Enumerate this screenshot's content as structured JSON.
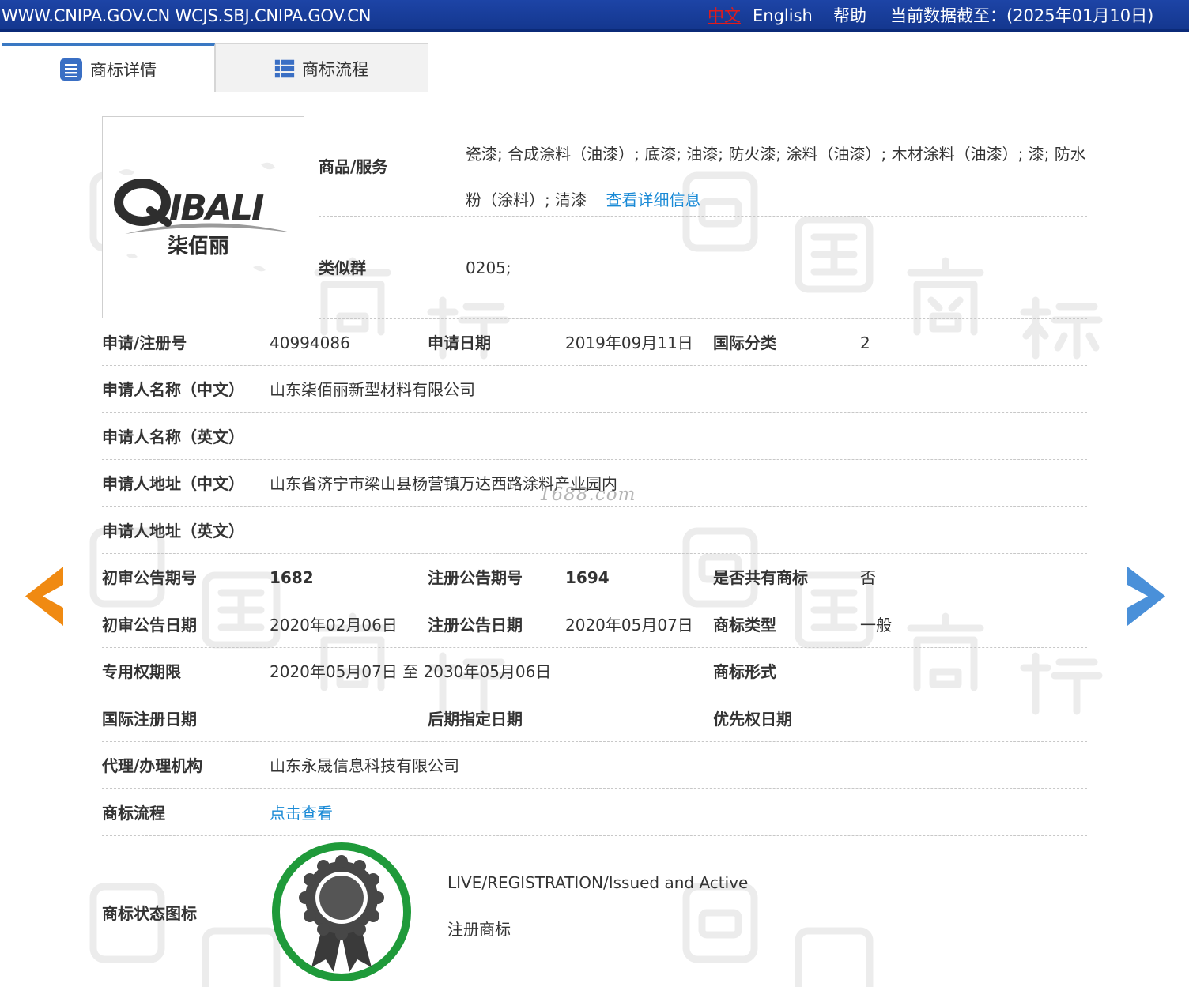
{
  "topbar": {
    "domains": "WWW.CNIPA.GOV.CN WCJS.SBJ.CNIPA.GOV.CN",
    "lang_zh": "中文",
    "lang_en": "English",
    "help": "帮助",
    "data_cutoff": "当前数据截至：(2025年01月10日)"
  },
  "tabs": [
    {
      "label": "商标详情",
      "icon": "list-doc-icon",
      "active": true
    },
    {
      "label": "商标流程",
      "icon": "table-list-icon",
      "active": false
    }
  ],
  "logo": {
    "latin_text": "QIBALI",
    "chinese_text": "柒佰丽"
  },
  "goods": {
    "label": "商品/服务",
    "text": "瓷漆; 合成涂料（油漆）; 底漆; 油漆; 防火漆; 涂料（油漆）; 木材涂料（油漆）; 漆; 防水粉（涂料）; 清漆",
    "detail_link": "查看详细信息"
  },
  "similar_group": {
    "label": "类似群",
    "value": "0205;"
  },
  "reg_no": {
    "label": "申请/注册号",
    "value": "40994086"
  },
  "apply_date": {
    "label": "申请日期",
    "value": "2019年09月11日"
  },
  "intl_class": {
    "label": "国际分类",
    "value": "2"
  },
  "applicant_cn": {
    "label": "申请人名称（中文）",
    "value": "山东柒佰丽新型材料有限公司"
  },
  "applicant_en": {
    "label": "申请人名称（英文）",
    "value": ""
  },
  "address_cn": {
    "label": "申请人地址（中文）",
    "value": "山东省济宁市梁山县杨营镇万达西路涂料产业园内"
  },
  "address_en": {
    "label": "申请人地址（英文）",
    "value": ""
  },
  "prelim_no": {
    "label": "初审公告期号",
    "value": "1682"
  },
  "reg_ann_no": {
    "label": "注册公告期号",
    "value": "1694"
  },
  "shared": {
    "label": "是否共有商标",
    "value": "否"
  },
  "prelim_date": {
    "label": "初审公告日期",
    "value": "2020年02月06日"
  },
  "reg_ann_date": {
    "label": "注册公告日期",
    "value": "2020年05月07日"
  },
  "tm_type": {
    "label": "商标类型",
    "value": "一般"
  },
  "exclusive_period": {
    "label": "专用权期限",
    "value": "2020年05月07日 至 2030年05月06日"
  },
  "tm_form": {
    "label": "商标形式",
    "value": ""
  },
  "intl_reg_date": {
    "label": "国际注册日期",
    "value": ""
  },
  "later_desig_date": {
    "label": "后期指定日期",
    "value": ""
  },
  "priority_date": {
    "label": "优先权日期",
    "value": ""
  },
  "agent": {
    "label": "代理/办理机构",
    "value": "山东永晟信息科技有限公司"
  },
  "process": {
    "label": "商标流程",
    "link": "点击查看"
  },
  "status": {
    "label": "商标状态图标",
    "en": "LIVE/REGISTRATION/Issued and Active",
    "cn": "注册商标",
    "icon": "registered-badge-icon",
    "ring_color": "#1f9a3a"
  },
  "watermark_1688": "1688.com",
  "nav": {
    "prev_icon": "arrow-left-icon",
    "next_icon": "arrow-right-icon",
    "prev_color": "#f08a12",
    "next_color": "#4a90d9"
  },
  "colors": {
    "topbar": "#1d44a6",
    "link": "#1a8ad6",
    "lang_active": "#e21b1b"
  }
}
